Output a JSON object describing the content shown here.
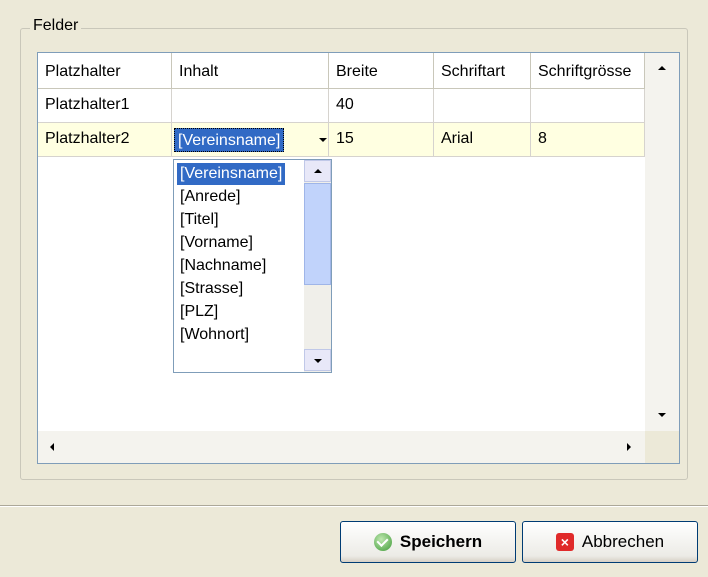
{
  "group": {
    "title": "Felder"
  },
  "table": {
    "headers": [
      "Platzhalter",
      "Inhalt",
      "Breite",
      "Schriftart",
      "Schriftgrösse"
    ],
    "rows": [
      [
        "Platzhalter1",
        "",
        "40",
        "",
        ""
      ],
      [
        "Platzhalter2",
        "[Vereinsname]",
        "15",
        "Arial",
        "8"
      ]
    ]
  },
  "combo": {
    "value": "[Vereinsname]",
    "options": [
      "[Vereinsname]",
      "[Anrede]",
      "[Titel]",
      "[Vorname]",
      "[Nachname]",
      "[Strasse]",
      "[PLZ]",
      "[Wohnort]"
    ]
  },
  "buttons": {
    "save_label": "Speichern",
    "cancel_label": "Abbrechen"
  },
  "icons": {
    "save": "check-circle-icon",
    "cancel": "close-x-icon"
  },
  "colors": {
    "selection": "#316ac5",
    "edit_row": "#ffffe1",
    "window_bg": "#ece9d8"
  }
}
